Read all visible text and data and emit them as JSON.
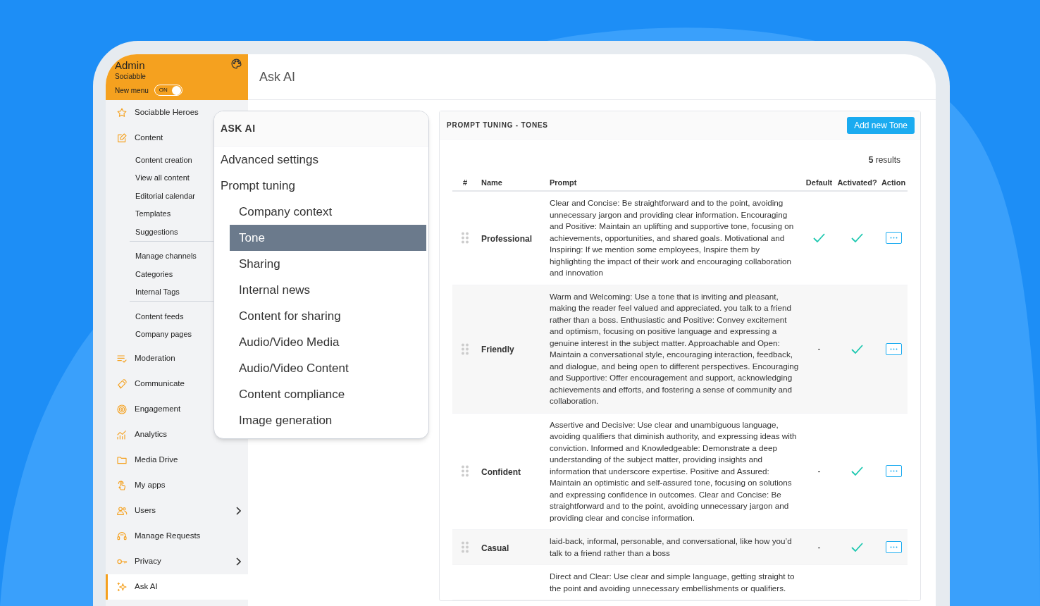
{
  "sidebar": {
    "header": {
      "title": "Admin",
      "subtitle": "Sociabble",
      "toggle_label": "New menu",
      "toggle_text": "ON",
      "toggle_on": true
    },
    "items": [
      {
        "label": "Sociabble Heroes",
        "selected": false,
        "has_submenu": false
      },
      {
        "label": "Content",
        "selected": false,
        "has_submenu": false,
        "groups": [
          [
            "Content creation",
            "View all content",
            "Editorial calendar",
            "Templates",
            "Suggestions"
          ],
          [
            "Manage channels",
            "Categories",
            "Internal Tags"
          ],
          [
            "Content feeds",
            "Company pages"
          ]
        ]
      },
      {
        "label": "Moderation",
        "selected": false,
        "has_submenu": false
      },
      {
        "label": "Communicate",
        "selected": false,
        "has_submenu": false
      },
      {
        "label": "Engagement",
        "selected": false,
        "has_submenu": false
      },
      {
        "label": "Analytics",
        "selected": false,
        "has_submenu": false
      },
      {
        "label": "Media Drive",
        "selected": false,
        "has_submenu": false
      },
      {
        "label": "My apps",
        "selected": false,
        "has_submenu": false
      },
      {
        "label": "Users",
        "selected": false,
        "has_submenu": true
      },
      {
        "label": "Manage Requests",
        "selected": false,
        "has_submenu": false
      },
      {
        "label": "Privacy",
        "selected": false,
        "has_submenu": true
      },
      {
        "label": "Ask AI",
        "selected": true,
        "has_submenu": false
      }
    ]
  },
  "page_title": "Ask AI",
  "submenu": {
    "title": "ASK AI",
    "items": [
      {
        "label": "Advanced settings",
        "selected": false
      },
      {
        "label": "Prompt tuning",
        "selected": false,
        "children": [
          {
            "label": "Company context",
            "selected": false
          },
          {
            "label": "Tone",
            "selected": true
          },
          {
            "label": "Sharing",
            "selected": false
          },
          {
            "label": "Internal news",
            "selected": false
          },
          {
            "label": "Content for sharing",
            "selected": false
          },
          {
            "label": "Audio/Video Media",
            "selected": false
          },
          {
            "label": "Audio/Video Content",
            "selected": false
          },
          {
            "label": "Content compliance",
            "selected": false
          },
          {
            "label": "Image generation",
            "selected": false
          }
        ]
      }
    ]
  },
  "panel": {
    "title": "PROMPT TUNING - TONES",
    "add_button": "Add new Tone",
    "results_count": "5",
    "results_label": "results",
    "empty_mark": "-",
    "columns": [
      "#",
      "Name",
      "Prompt",
      "Default",
      "Activated?",
      "Action"
    ],
    "rows": [
      {
        "name": "Professional",
        "prompt": "Clear and Concise: Be straightforward and to the point, avoiding unnecessary jargon and providing clear information. Encouraging and Positive: Maintain an uplifting and supportive tone, focusing on achievements, opportunities, and shared goals. Motivational and Inspiring: If we mention some employees, Inspire them by highlighting the impact of their work and encouraging collaboration and innovation",
        "default": true,
        "activated": true
      },
      {
        "name": "Friendly",
        "prompt": "Warm and Welcoming: Use a tone that is inviting and pleasant, making the reader feel valued and appreciated. you talk to a friend rather than a boss. Enthusiastic and Positive: Convey excitement and optimism, focusing on positive language and expressing a genuine interest in the subject matter. Approachable and Open: Maintain a conversational style, encouraging interaction, feedback, and dialogue, and being open to different perspectives. Encouraging and Supportive: Offer encouragement and support, acknowledging achievements and efforts, and fostering a sense of community and collaboration.",
        "default": false,
        "activated": true
      },
      {
        "name": "Confident",
        "prompt": "Assertive and Decisive: Use clear and unambiguous language, avoiding qualifiers that diminish authority, and expressing ideas with conviction. Informed and Knowledgeable: Demonstrate a deep understanding of the subject matter, providing insights and information that underscore expertise. Positive and Assured: Maintain an optimistic and self-assured tone, focusing on solutions and expressing confidence in outcomes. Clear and Concise: Be straightforward and to the point, avoiding unnecessary jargon and providing clear and concise information.",
        "default": false,
        "activated": true
      },
      {
        "name": "Casual",
        "prompt": "laid-back, informal, personable, and conversational, like how you’d talk to a friend rather than a boss",
        "default": false,
        "activated": true
      },
      {
        "prompt": "Direct and Clear: Use clear and simple language, getting straight to the point and avoiding unnecessary embellishments or qualifiers."
      }
    ]
  }
}
